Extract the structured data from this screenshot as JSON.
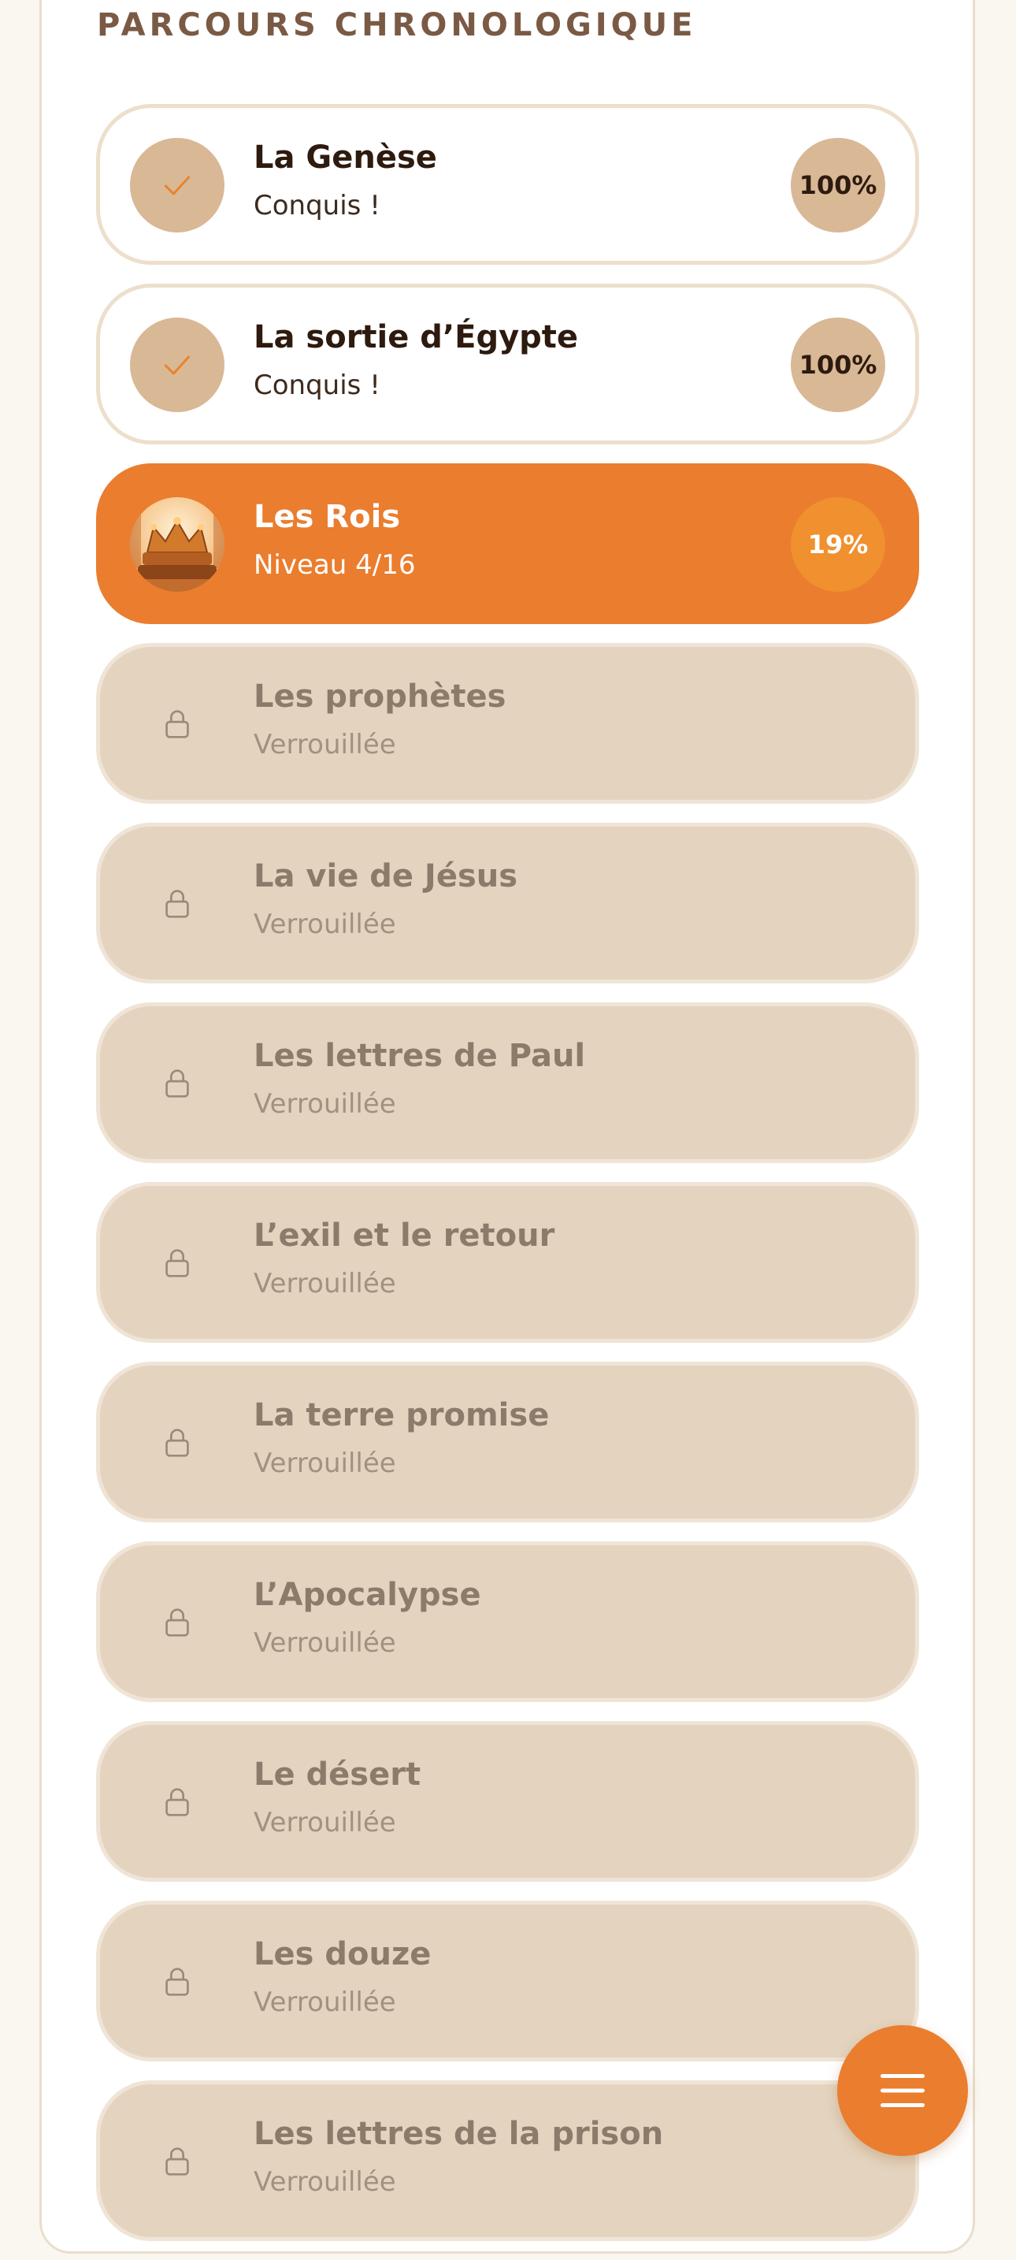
{
  "section": {
    "title": "PARCOURS CHRONOLOGIQUE"
  },
  "colors": {
    "accent": "#EA7D2E",
    "done_badge": "#D9B896",
    "locked_card": "#E4D4BF"
  },
  "journeys": [
    {
      "title": "La Genèse",
      "subtitle": "Conquis !",
      "percent": "100%",
      "state": "done",
      "icon": "check-icon"
    },
    {
      "title": "La sortie d’Égypte",
      "subtitle": "Conquis !",
      "percent": "100%",
      "state": "done",
      "icon": "check-icon"
    },
    {
      "title": "Les Rois",
      "subtitle": "Niveau 4/16",
      "percent": "19%",
      "state": "current",
      "icon": "crown-thumbnail"
    },
    {
      "title": "Les prophètes",
      "subtitle": "Verrouillée",
      "state": "locked",
      "icon": "lock-icon"
    },
    {
      "title": "La vie de Jésus",
      "subtitle": "Verrouillée",
      "state": "locked",
      "icon": "lock-icon"
    },
    {
      "title": "Les lettres de Paul",
      "subtitle": "Verrouillée",
      "state": "locked",
      "icon": "lock-icon"
    },
    {
      "title": "L’exil et le retour",
      "subtitle": "Verrouillée",
      "state": "locked",
      "icon": "lock-icon"
    },
    {
      "title": "La terre promise",
      "subtitle": "Verrouillée",
      "state": "locked",
      "icon": "lock-icon"
    },
    {
      "title": "L’Apocalypse",
      "subtitle": "Verrouillée",
      "state": "locked",
      "icon": "lock-icon"
    },
    {
      "title": "Le désert",
      "subtitle": "Verrouillée",
      "state": "locked",
      "icon": "lock-icon"
    },
    {
      "title": "Les douze",
      "subtitle": "Verrouillée",
      "state": "locked",
      "icon": "lock-icon"
    },
    {
      "title": "Les lettres de la prison",
      "subtitle": "Verrouillée",
      "state": "locked",
      "icon": "lock-icon"
    }
  ],
  "fab": {
    "icon": "menu-icon"
  }
}
